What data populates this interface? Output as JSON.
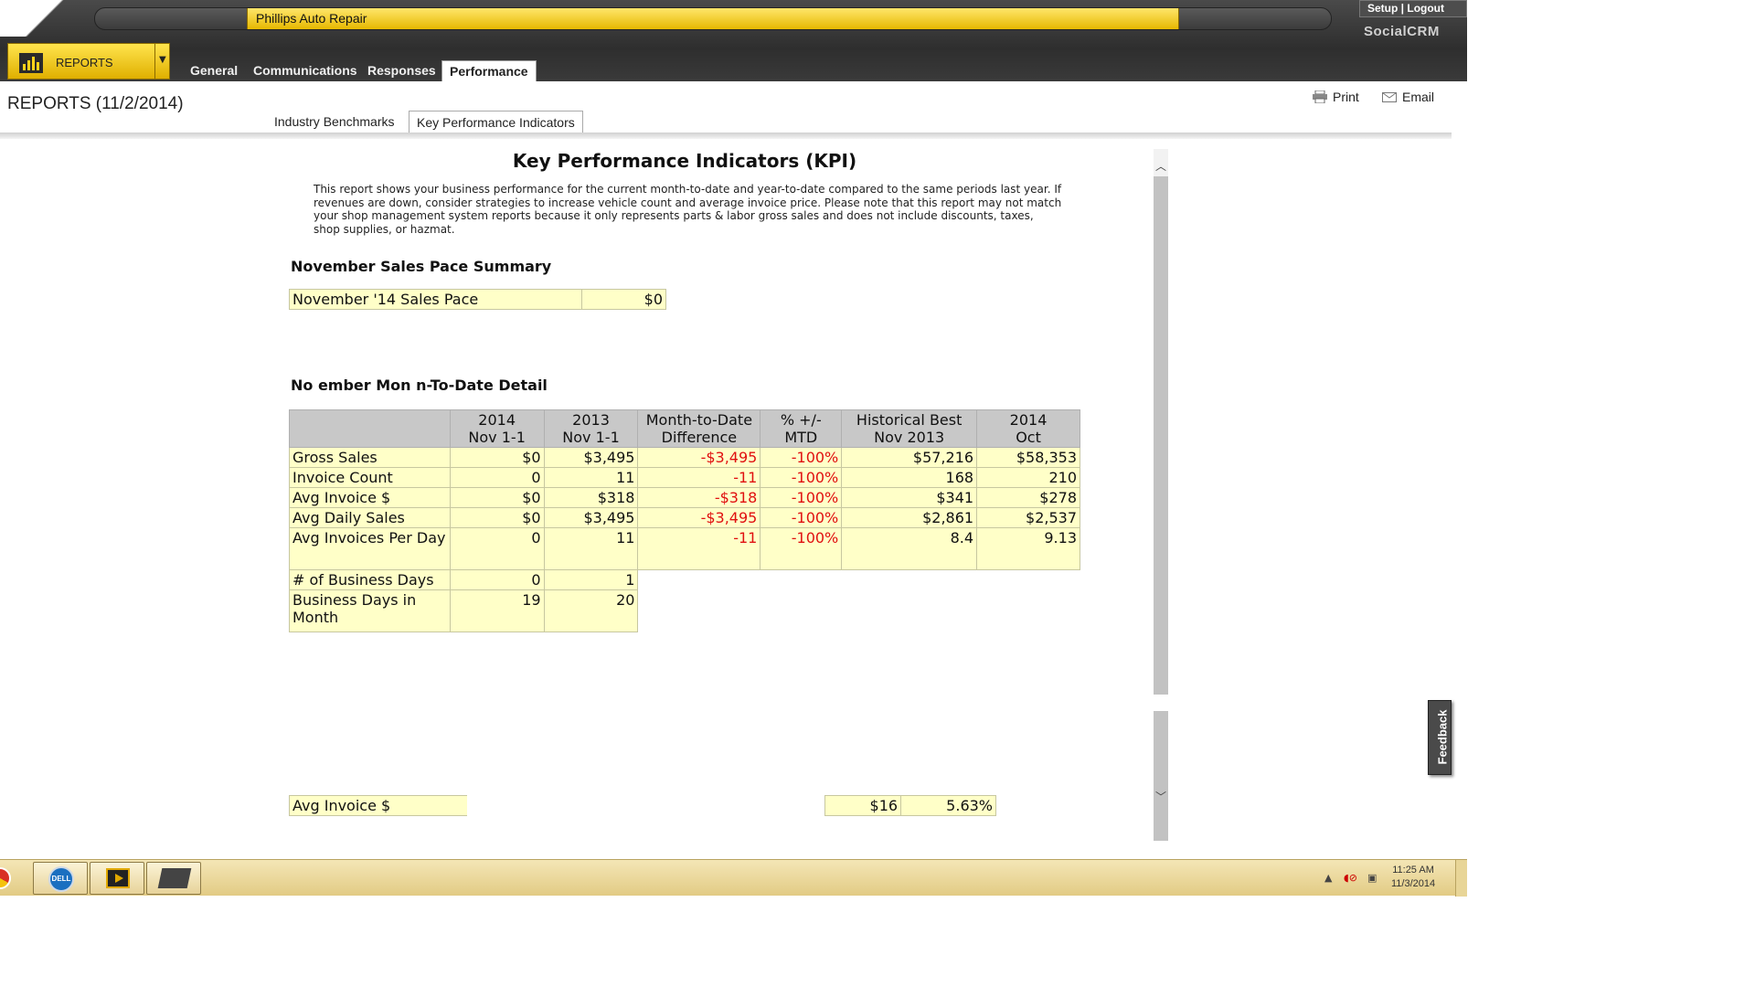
{
  "header": {
    "company_name": "Phillips Auto Repair",
    "setup_logout": "Setup | Logout",
    "brand": "SocialCRM",
    "menu_button": "REPORTS",
    "nav_tabs": [
      {
        "label": "General"
      },
      {
        "label": "Communications"
      },
      {
        "label": "Responses"
      },
      {
        "label": "Performance",
        "active": true
      }
    ]
  },
  "page": {
    "title": "REPORTS (11/2/2014)",
    "print_label": "Print",
    "email_label": "Email",
    "sub_tabs": [
      {
        "label": "Industry Benchmarks"
      },
      {
        "label": "Key Performance Indicators",
        "active": true
      }
    ]
  },
  "report": {
    "title": "Key Performance Indicators (KPI)",
    "description": "This report shows your business performance for the current month-to-date and year-to-date compared to the same periods last year. If revenues are down, consider strategies to increase vehicle count and average invoice price. Please note that this report may not match your shop management system reports because it only represents parts & labor gross sales and does not include discounts, taxes, shop supplies, or hazmat.",
    "pace_section_title": "November Sales Pace Summary",
    "pace_label": "November '14 Sales Pace",
    "pace_value": "$0",
    "mtd_section_title": "No  ember Mon  n-To-Date Detail",
    "mtd_headers": [
      {
        "l1": "",
        "l2": ""
      },
      {
        "l1": "2014",
        "l2": "Nov 1-1"
      },
      {
        "l1": "2013",
        "l2": "Nov 1-1"
      },
      {
        "l1": "Month-to-Date",
        "l2": "Difference"
      },
      {
        "l1": "% +/-",
        "l2": "MTD"
      },
      {
        "l1": "Historical Best",
        "l2": "Nov 2013"
      },
      {
        "l1": "2014",
        "l2": "Oct"
      }
    ],
    "mtd_rows": [
      {
        "label": "Gross Sales",
        "cur": "$0",
        "prev": "$3,495",
        "diff": "-$3,495",
        "pct": "-100%",
        "best": "$57,216",
        "last": "$58,353"
      },
      {
        "label": "Invoice Count",
        "cur": "0",
        "prev": "11",
        "diff": "-11",
        "pct": "-100%",
        "best": "168",
        "last": "210"
      },
      {
        "label": "Avg Invoice $",
        "cur": "$0",
        "prev": "$318",
        "diff": "-$318",
        "pct": "-100%",
        "best": "$341",
        "last": "$278"
      },
      {
        "label": "Avg Daily Sales",
        "cur": "$0",
        "prev": "$3,495",
        "diff": "-$3,495",
        "pct": "-100%",
        "best": "$2,861",
        "last": "$2,537"
      },
      {
        "label": "Avg Invoices Per Day",
        "cur": "0",
        "prev": "11",
        "diff": "-11",
        "pct": "-100%",
        "best": "8.4",
        "last": "9.13"
      }
    ],
    "mtd_rows_short": [
      {
        "label": "# of Business Days",
        "cur": "0",
        "prev": "1"
      },
      {
        "label": "Business Days in Month",
        "cur": "19",
        "prev": "20"
      }
    ],
    "partial_row": {
      "label": "Avg Invoice $",
      "col2": "$16",
      "col3": "5.63%"
    }
  },
  "feedback_label": "Feedback",
  "taskbar": {
    "clock_time": "11:25 AM",
    "clock_date": "11/3/2014",
    "dell_label": "DELL"
  }
}
